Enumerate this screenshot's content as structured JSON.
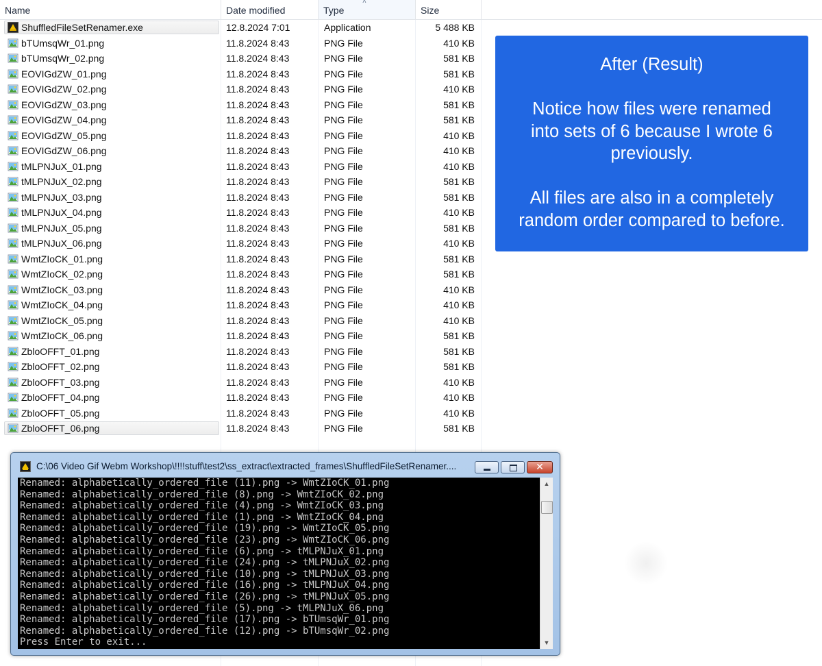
{
  "columns": {
    "name": "Name",
    "date": "Date modified",
    "type": "Type",
    "size": "Size"
  },
  "files": [
    {
      "name": "ShuffledFileSetRenamer.exe",
      "date": "12.8.2024 7:01",
      "type": "Application",
      "size": "5 488 KB",
      "icon": "application-icon"
    },
    {
      "name": "bTUmsqWr_01.png",
      "date": "11.8.2024 8:43",
      "type": "PNG File",
      "size": "410 KB",
      "icon": "png-image-icon"
    },
    {
      "name": "bTUmsqWr_02.png",
      "date": "11.8.2024 8:43",
      "type": "PNG File",
      "size": "581 KB",
      "icon": "png-image-icon"
    },
    {
      "name": "EOVIGdZW_01.png",
      "date": "11.8.2024 8:43",
      "type": "PNG File",
      "size": "581 KB",
      "icon": "png-image-icon"
    },
    {
      "name": "EOVIGdZW_02.png",
      "date": "11.8.2024 8:43",
      "type": "PNG File",
      "size": "410 KB",
      "icon": "png-image-icon"
    },
    {
      "name": "EOVIGdZW_03.png",
      "date": "11.8.2024 8:43",
      "type": "PNG File",
      "size": "581 KB",
      "icon": "png-image-icon"
    },
    {
      "name": "EOVIGdZW_04.png",
      "date": "11.8.2024 8:43",
      "type": "PNG File",
      "size": "581 KB",
      "icon": "png-image-icon"
    },
    {
      "name": "EOVIGdZW_05.png",
      "date": "11.8.2024 8:43",
      "type": "PNG File",
      "size": "410 KB",
      "icon": "png-image-icon"
    },
    {
      "name": "EOVIGdZW_06.png",
      "date": "11.8.2024 8:43",
      "type": "PNG File",
      "size": "410 KB",
      "icon": "png-image-icon"
    },
    {
      "name": "tMLPNJuX_01.png",
      "date": "11.8.2024 8:43",
      "type": "PNG File",
      "size": "410 KB",
      "icon": "png-image-icon"
    },
    {
      "name": "tMLPNJuX_02.png",
      "date": "11.8.2024 8:43",
      "type": "PNG File",
      "size": "581 KB",
      "icon": "png-image-icon"
    },
    {
      "name": "tMLPNJuX_03.png",
      "date": "11.8.2024 8:43",
      "type": "PNG File",
      "size": "581 KB",
      "icon": "png-image-icon"
    },
    {
      "name": "tMLPNJuX_04.png",
      "date": "11.8.2024 8:43",
      "type": "PNG File",
      "size": "410 KB",
      "icon": "png-image-icon"
    },
    {
      "name": "tMLPNJuX_05.png",
      "date": "11.8.2024 8:43",
      "type": "PNG File",
      "size": "581 KB",
      "icon": "png-image-icon"
    },
    {
      "name": "tMLPNJuX_06.png",
      "date": "11.8.2024 8:43",
      "type": "PNG File",
      "size": "410 KB",
      "icon": "png-image-icon"
    },
    {
      "name": "WmtZIoCK_01.png",
      "date": "11.8.2024 8:43",
      "type": "PNG File",
      "size": "581 KB",
      "icon": "png-image-icon"
    },
    {
      "name": "WmtZIoCK_02.png",
      "date": "11.8.2024 8:43",
      "type": "PNG File",
      "size": "581 KB",
      "icon": "png-image-icon"
    },
    {
      "name": "WmtZIoCK_03.png",
      "date": "11.8.2024 8:43",
      "type": "PNG File",
      "size": "410 KB",
      "icon": "png-image-icon"
    },
    {
      "name": "WmtZIoCK_04.png",
      "date": "11.8.2024 8:43",
      "type": "PNG File",
      "size": "410 KB",
      "icon": "png-image-icon"
    },
    {
      "name": "WmtZIoCK_05.png",
      "date": "11.8.2024 8:43",
      "type": "PNG File",
      "size": "410 KB",
      "icon": "png-image-icon"
    },
    {
      "name": "WmtZIoCK_06.png",
      "date": "11.8.2024 8:43",
      "type": "PNG File",
      "size": "581 KB",
      "icon": "png-image-icon"
    },
    {
      "name": "ZbloOFFT_01.png",
      "date": "11.8.2024 8:43",
      "type": "PNG File",
      "size": "581 KB",
      "icon": "png-image-icon"
    },
    {
      "name": "ZbloOFFT_02.png",
      "date": "11.8.2024 8:43",
      "type": "PNG File",
      "size": "581 KB",
      "icon": "png-image-icon"
    },
    {
      "name": "ZbloOFFT_03.png",
      "date": "11.8.2024 8:43",
      "type": "PNG File",
      "size": "410 KB",
      "icon": "png-image-icon"
    },
    {
      "name": "ZbloOFFT_04.png",
      "date": "11.8.2024 8:43",
      "type": "PNG File",
      "size": "410 KB",
      "icon": "png-image-icon"
    },
    {
      "name": "ZbloOFFT_05.png",
      "date": "11.8.2024 8:43",
      "type": "PNG File",
      "size": "410 KB",
      "icon": "png-image-icon"
    },
    {
      "name": "ZbloOFFT_06.png",
      "date": "11.8.2024 8:43",
      "type": "PNG File",
      "size": "581 KB",
      "icon": "png-image-icon"
    }
  ],
  "highlighted_rows": [
    0,
    26
  ],
  "note": {
    "title": "After (Result)",
    "paragraph1": [
      "Notice how files were renamed",
      "into sets of 6 because I wrote 6",
      "previously."
    ],
    "paragraph2": [
      "All files are also in a completely",
      "random order compared to before."
    ],
    "background_color": "#2167e2"
  },
  "console": {
    "title": "C:\\06 Video Gif Webm Workshop\\!!!!stuff\\test2\\ss_extract\\extracted_frames\\ShuffledFileSetRenamer....",
    "icon": "console-app-icon",
    "buttons": {
      "minimize": "minimize-icon",
      "maximize": "maximize-icon",
      "close": "close-icon",
      "close_glyph": "✕"
    },
    "lines": [
      "Renamed: alphabetically_ordered_file (11).png -> WmtZIoCK_01.png",
      "Renamed: alphabetically_ordered_file (8).png -> WmtZIoCK_02.png",
      "Renamed: alphabetically_ordered_file (4).png -> WmtZIoCK_03.png",
      "Renamed: alphabetically_ordered_file (1).png -> WmtZIoCK_04.png",
      "Renamed: alphabetically_ordered_file (19).png -> WmtZIoCK_05.png",
      "Renamed: alphabetically_ordered_file (23).png -> WmtZIoCK_06.png",
      "Renamed: alphabetically_ordered_file (6).png -> tMLPNJuX_01.png",
      "Renamed: alphabetically_ordered_file (24).png -> tMLPNJuX_02.png",
      "Renamed: alphabetically_ordered_file (10).png -> tMLPNJuX_03.png",
      "Renamed: alphabetically_ordered_file (16).png -> tMLPNJuX_04.png",
      "Renamed: alphabetically_ordered_file (26).png -> tMLPNJuX_05.png",
      "Renamed: alphabetically_ordered_file (5).png -> tMLPNJuX_06.png",
      "Renamed: alphabetically_ordered_file (17).png -> bTUmsqWr_01.png",
      "Renamed: alphabetically_ordered_file (12).png -> bTUmsqWr_02.png",
      "Press Enter to exit..."
    ],
    "text_color": "#c8c8c8",
    "background_color": "#000000"
  }
}
